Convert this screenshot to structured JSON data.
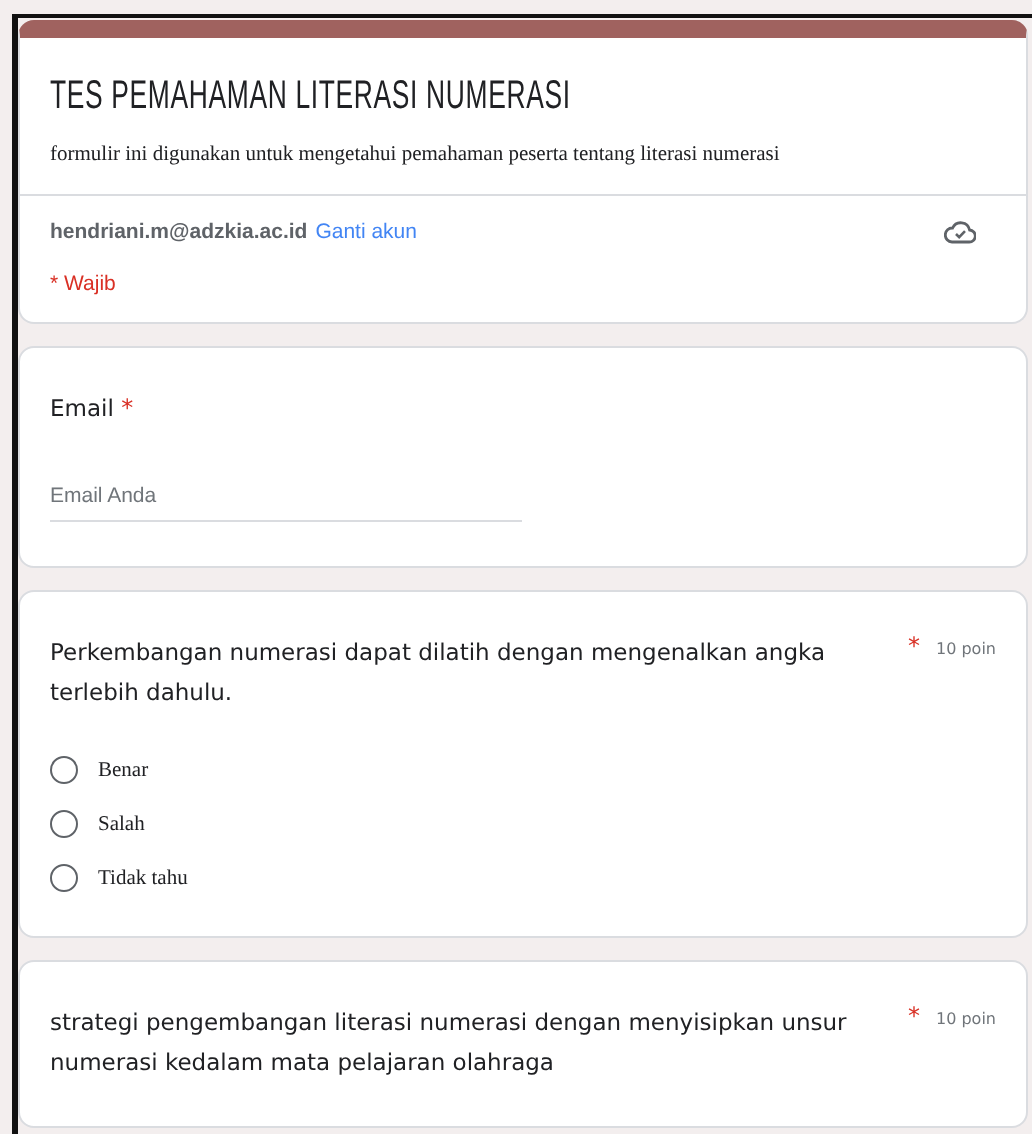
{
  "form": {
    "title": "TES PEMAHAMAN LITERASI NUMERASI",
    "description": "formulir ini digunakan untuk mengetahui pemahaman peserta tentang literasi numerasi",
    "account_email": "hendriani.m@adzkia.ac.id",
    "switch_account": "Ganti akun",
    "required_note": "* Wajib"
  },
  "questions": [
    {
      "kind": "text",
      "title": "Email",
      "required_mark": "*",
      "placeholder": "Email Anda"
    },
    {
      "kind": "choice",
      "title": "Perkembangan numerasi dapat dilatih dengan mengenalkan angka terlebih dahulu.",
      "required_mark": "*",
      "points": "10 poin",
      "options": [
        {
          "label": "Benar",
          "selected": false
        },
        {
          "label": "Salah",
          "selected": false
        },
        {
          "label": "Tidak tahu",
          "selected": false
        }
      ]
    },
    {
      "kind": "choice",
      "title": "strategi pengembangan literasi numerasi dengan menyisipkan unsur numerasi kedalam mata pelajaran olahraga",
      "required_mark": "*",
      "points": "10 poin"
    }
  ]
}
